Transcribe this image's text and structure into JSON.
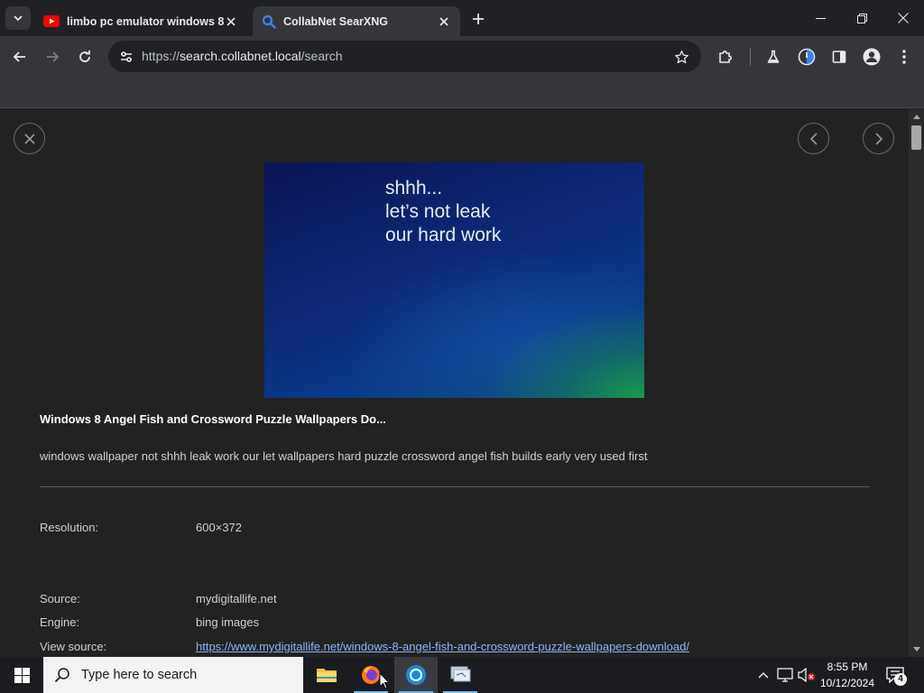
{
  "browser": {
    "tabs": [
      {
        "title": "limbo pc emulator windows 8 l",
        "icon": "youtube-icon",
        "active": false
      },
      {
        "title": "CollabNet SearXNG",
        "icon": "search-icon",
        "active": true
      }
    ],
    "url_scheme": "https://",
    "url_host": "search.collabnet.local",
    "url_path": "/search"
  },
  "viewer": {
    "image_text_line1": "shhh...",
    "image_text_line2": "let’s not leak",
    "image_text_line3": "our hard work",
    "title": "Windows 8 Angel Fish and Crossword Puzzle Wallpapers Do...",
    "description": "windows wallpaper not shhh leak work our let wallpapers hard puzzle crossword angel fish builds early very used first",
    "meta": {
      "resolution_label": "Resolution:",
      "resolution_value": "600×372",
      "source_label": "Source:",
      "source_value": "mydigitallife.net",
      "engine_label": "Engine:",
      "engine_value": "bing images",
      "view_source_label": "View source:",
      "view_source_value": "https://www.mydigitallife.net/windows-8-angel-fish-and-crossword-puzzle-wallpapers-download/"
    }
  },
  "taskbar": {
    "search_placeholder": "Type here to search",
    "time": "8:55 PM",
    "date": "10/12/2024",
    "notification_count": "4"
  },
  "colors": {
    "accent": "#8ab4f8",
    "page_bg": "#222222",
    "chrome_bg": "#35363a"
  }
}
